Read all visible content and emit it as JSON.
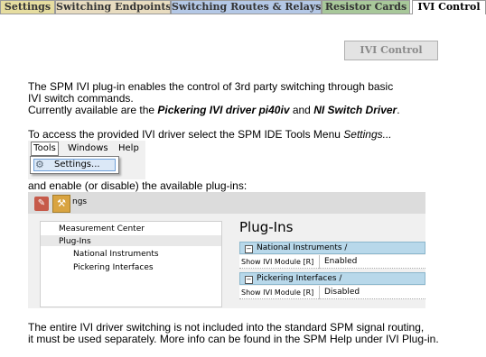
{
  "tabs": [
    {
      "label": "Settings"
    },
    {
      "label": "Switching Endpoints"
    },
    {
      "label": "Switching Routes & Relays"
    },
    {
      "label": "Resistor Cards"
    },
    {
      "label": "IVI Control"
    }
  ],
  "ivi_button": "IVI Control",
  "intro": {
    "line1": "The SPM IVI plug-in enables the control of 3rd party switching through basic",
    "line2": "IVI switch commands.",
    "line3_prefix": "Currently available are the ",
    "driver1": "Pickering IVI driver pi40iv",
    "line3_mid": " and ",
    "driver2": "NI Switch Driver",
    "line3_suffix": "."
  },
  "access": {
    "prefix": "To access the provided IVI driver select the SPM IDE Tools Menu ",
    "italic": "Settings...",
    "suffix": ""
  },
  "menu": {
    "tools": "Tools",
    "windows": "Windows",
    "help": "Help",
    "settings_item": "Settings..."
  },
  "enable_text": "and enable (or disable) the available plug-ins:",
  "dialog": {
    "title_fragment": "ngs",
    "tree": [
      "Measurement Center",
      "Plug-Ins",
      "National Instruments",
      "Pickering Interfaces"
    ],
    "panel_title": "Plug-Ins",
    "groups": [
      {
        "label": "National Instruments /",
        "row_key": "Show IVI Module [R]",
        "row_value": "Enabled"
      },
      {
        "label": "Pickering Interfaces /",
        "row_key": "Show IVI Module [R]",
        "row_value": "Disabled"
      }
    ],
    "toggle_glyph": "−"
  },
  "footer": {
    "line1": "The entire IVI driver switching is not included into the standard SPM signal routing,",
    "line2": "it must be used separately. More info can be found in the SPM Help under IVI Plug-in."
  }
}
